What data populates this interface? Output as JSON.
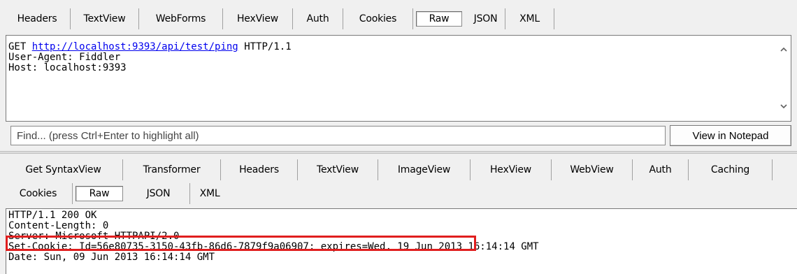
{
  "request": {
    "tabs": [
      "Headers",
      "TextView",
      "WebForms",
      "HexView",
      "Auth",
      "Cookies",
      "Raw",
      "JSON",
      "XML"
    ],
    "active_tab": "Raw",
    "raw": {
      "method": "GET",
      "url": "http://localhost:9393/api/test/ping",
      "protocol": "HTTP/1.1",
      "lines": [
        "User-Agent: Fiddler",
        "Host: localhost:9393"
      ]
    },
    "scroll_up_icon": "chevron-up-icon",
    "scroll_down_icon": "chevron-down-icon"
  },
  "find": {
    "placeholder": "Find... (press Ctrl+Enter to highlight all)",
    "value": "",
    "button_label": "View in Notepad"
  },
  "response": {
    "tabs_row1": [
      "Get SyntaxView",
      "Transformer",
      "Headers",
      "TextView",
      "ImageView",
      "HexView",
      "WebView",
      "Auth",
      "Caching"
    ],
    "tabs_row2": [
      "Cookies",
      "Raw",
      "JSON",
      "XML"
    ],
    "active_tab": "Raw",
    "raw": {
      "lines": [
        "HTTP/1.1 200 OK",
        "Content-Length: 0",
        "Server: Microsoft-HTTPAPI/2.0"
      ],
      "set_cookie_highlighted": "Set-Cookie: Id=56e80735-3150-43fb-86d6-7879f9a06907;",
      "set_cookie_rest": " expires=Wed, 19 Jun 2013 16:14:14 GMT",
      "date_line": "Date: Sun, 09 Jun 2013 16:14:14 GMT"
    }
  },
  "colors": {
    "highlight_border": "#e01e1e",
    "link": "#0000ee"
  }
}
